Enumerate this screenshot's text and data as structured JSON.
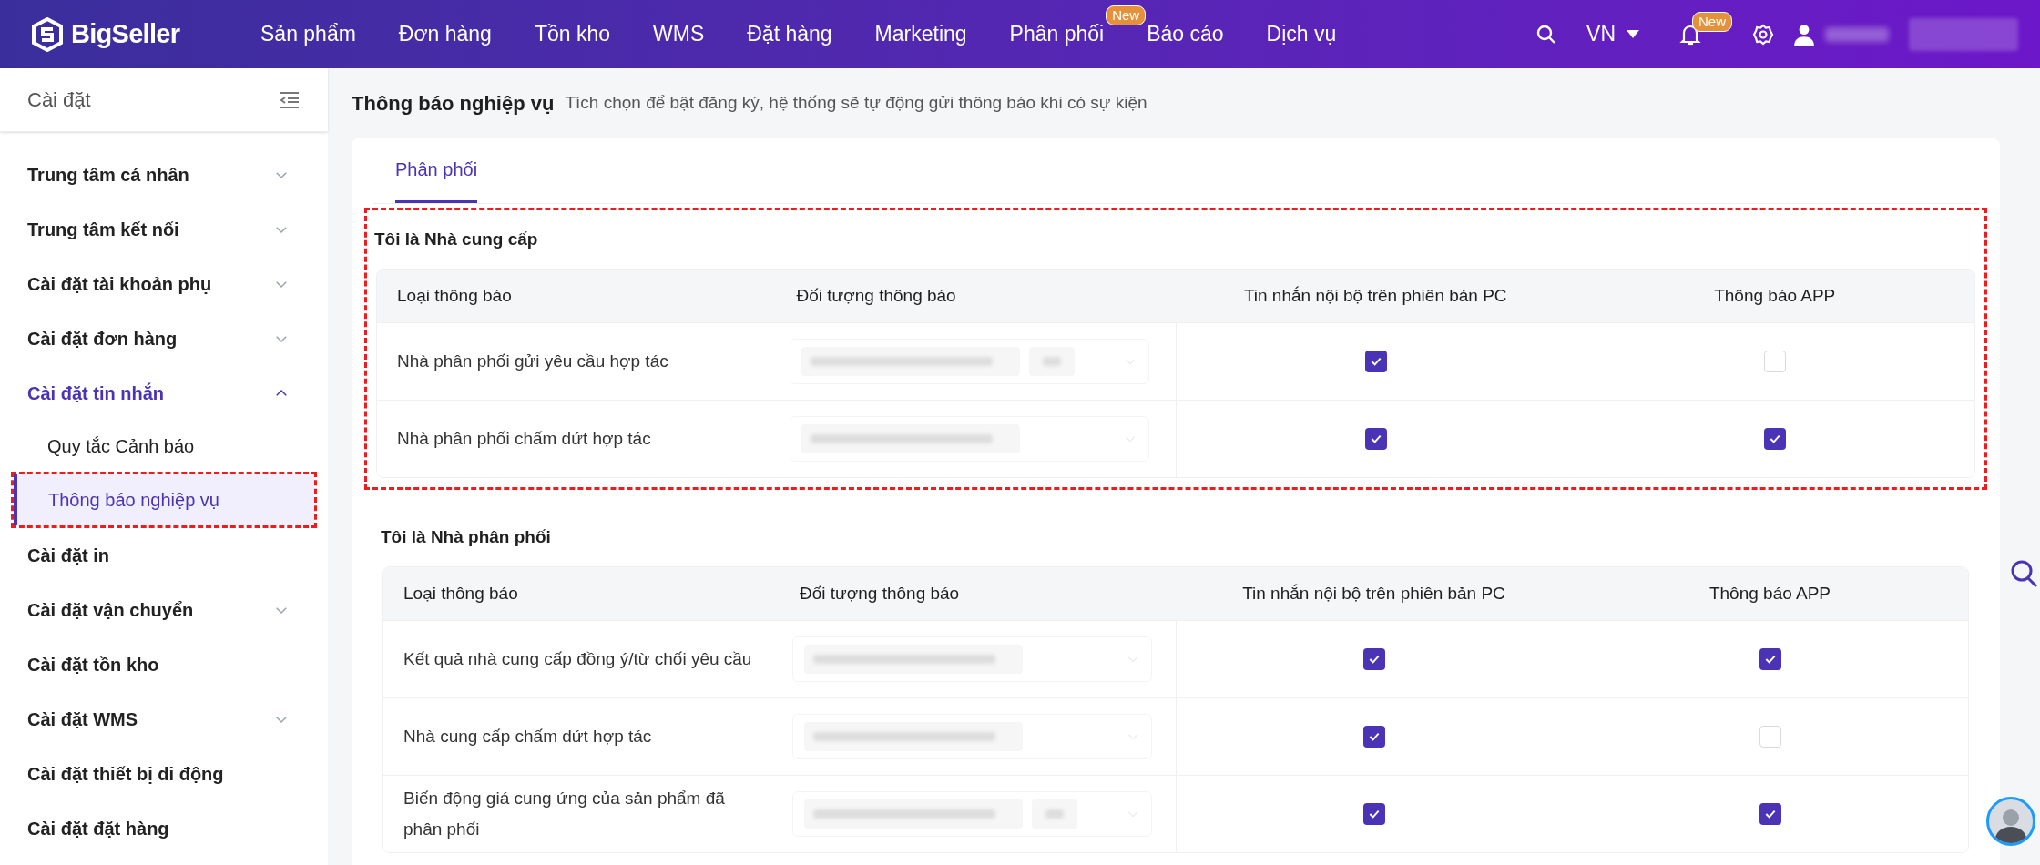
{
  "topbar": {
    "logo": "BigSeller",
    "nav": [
      {
        "label": "Sản phẩm"
      },
      {
        "label": "Đơn hàng"
      },
      {
        "label": "Tồn kho"
      },
      {
        "label": "WMS"
      },
      {
        "label": "Đặt hàng"
      },
      {
        "label": "Marketing"
      },
      {
        "label": "Phân phối",
        "badge": "New"
      },
      {
        "label": "Báo cáo"
      },
      {
        "label": "Dịch vụ"
      }
    ],
    "language": "VN",
    "notification_badge": "New"
  },
  "sidebar": {
    "title": "Cài đặt",
    "items": [
      {
        "label": "Trung tâm cá nhân",
        "kind": "group",
        "expanded": false,
        "selected": false
      },
      {
        "label": "Trung tâm kết nối",
        "kind": "group",
        "expanded": false,
        "selected": false
      },
      {
        "label": "Cài đặt tài khoản phụ",
        "kind": "group",
        "expanded": false,
        "selected": false
      },
      {
        "label": "Cài đặt đơn hàng",
        "kind": "group",
        "expanded": false,
        "selected": false
      },
      {
        "label": "Cài đặt tin nhắn",
        "kind": "group",
        "expanded": true,
        "selected": true,
        "children": [
          {
            "label": "Quy tắc Cảnh báo",
            "selected": false,
            "highlighted": false
          },
          {
            "label": "Thông báo nghiệp vụ",
            "selected": true,
            "highlighted": true
          }
        ]
      },
      {
        "label": "Cài đặt in",
        "kind": "link",
        "selected": false
      },
      {
        "label": "Cài đặt vận chuyển",
        "kind": "group",
        "expanded": false,
        "selected": false
      },
      {
        "label": "Cài đặt tồn kho",
        "kind": "link",
        "selected": false
      },
      {
        "label": "Cài đặt WMS",
        "kind": "group",
        "expanded": false,
        "selected": false
      },
      {
        "label": "Cài đặt thiết bị di động",
        "kind": "link",
        "selected": false
      },
      {
        "label": "Cài đặt đặt hàng",
        "kind": "link",
        "selected": false
      }
    ]
  },
  "main": {
    "title": "Thông báo nghiệp vụ",
    "subtitle": "Tích chọn để bật đăng ký, hệ thống sẽ tự động gửi thông báo khi có sự kiện",
    "tabs": [
      {
        "label": "Phân phối",
        "selected": true
      }
    ],
    "sections": [
      {
        "title": "Tôi là Nhà cung cấp",
        "highlighted": true,
        "columns": [
          "Loại thông báo",
          "Đối tượng thông báo",
          "Tin nhắn nội bộ trên phiên bản PC",
          "Thông báo APP"
        ],
        "rows": [
          {
            "type": "Nhà phân phối gửi yêu cầu hợp tác",
            "more_recipients": true,
            "pc_message": true,
            "app": false
          },
          {
            "type": "Nhà phân phối chấm dứt hợp tác",
            "more_recipients": false,
            "pc_message": true,
            "app": true
          }
        ]
      },
      {
        "title": "Tôi là Nhà phân phối",
        "highlighted": false,
        "columns": [
          "Loại thông báo",
          "Đối tượng thông báo",
          "Tin nhắn nội bộ trên phiên bản PC",
          "Thông báo APP"
        ],
        "rows": [
          {
            "type": "Kết quả nhà cung cấp đồng ý/từ chối yêu cầu",
            "more_recipients": false,
            "pc_message": true,
            "app": true
          },
          {
            "type": "Nhà cung cấp chấm dứt hợp tác",
            "more_recipients": false,
            "pc_message": true,
            "app": false
          },
          {
            "type": "Biến động giá cung ứng của sản phẩm đã phân phối",
            "more_recipients": true,
            "pc_message": true,
            "app": true
          }
        ]
      }
    ]
  }
}
